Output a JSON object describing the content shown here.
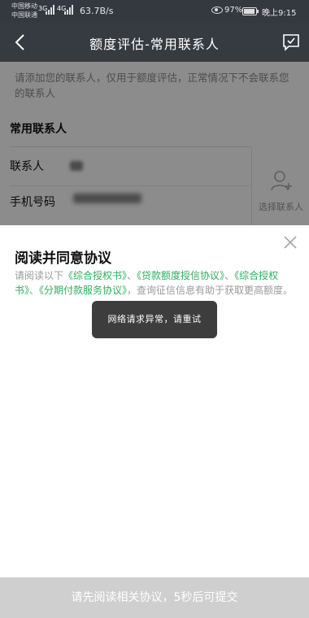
{
  "status_bar": {
    "carrier_1": "中国移动",
    "carrier_2": "中国联通",
    "network_1": "3G",
    "network_2": "4G",
    "speed": "63.7B/s",
    "battery_percent": "97%",
    "time": "晚上9:15"
  },
  "nav": {
    "title": "额度评估-常用联系人",
    "back_icon": "back-chevron-icon",
    "feedback_icon": "chat-feedback-icon"
  },
  "form": {
    "notice": "请添加您的联系人，仅用于额度评估，正常情况下不会联系您的联系人",
    "section_title": "常用联系人",
    "contact_label": "联系人",
    "phone_label": "手机号码",
    "pick_contact_label": "选择联系人",
    "pick_contact_icon": "add-person-icon"
  },
  "agreement": {
    "title": "阅读并同意协议",
    "intro": "请阅读以下",
    "link_1": "《综合授权书》",
    "sep_1": "、",
    "link_2": "《贷款额度授信协议》",
    "sep_2": "、",
    "link_3": "《综合授权书》",
    "sep_3": "、",
    "link_4": "《分期付款服务协议》",
    "outro": "，查询征信信息有助于获取更高额度。",
    "close_icon": "close-icon",
    "link_color": "#2fae5f"
  },
  "toast": {
    "message": "网络请求异常，请重试"
  },
  "footer": {
    "submit_label": "请先阅读相关协议，5秒后可提交"
  }
}
